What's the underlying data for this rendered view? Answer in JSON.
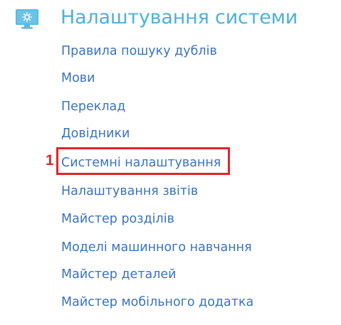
{
  "section": {
    "icon": "settings-monitor-icon",
    "title": "Налаштування системи"
  },
  "menu": {
    "items": [
      {
        "label": "Правила пошуку дублів"
      },
      {
        "label": "Мови"
      },
      {
        "label": "Переклад"
      },
      {
        "label": "Довідники"
      },
      {
        "label": "Системні налаштування"
      },
      {
        "label": "Налаштування звітів"
      },
      {
        "label": "Майстер розділів"
      },
      {
        "label": "Моделі машинного навчання"
      },
      {
        "label": "Майстер деталей"
      },
      {
        "label": "Майстер мобільного додатка"
      }
    ]
  },
  "annotation": {
    "step": "1",
    "color": "#e3242b"
  },
  "colors": {
    "title": "#4fb0d8",
    "link": "#3a73c0",
    "icon": "#5bb8e0"
  }
}
